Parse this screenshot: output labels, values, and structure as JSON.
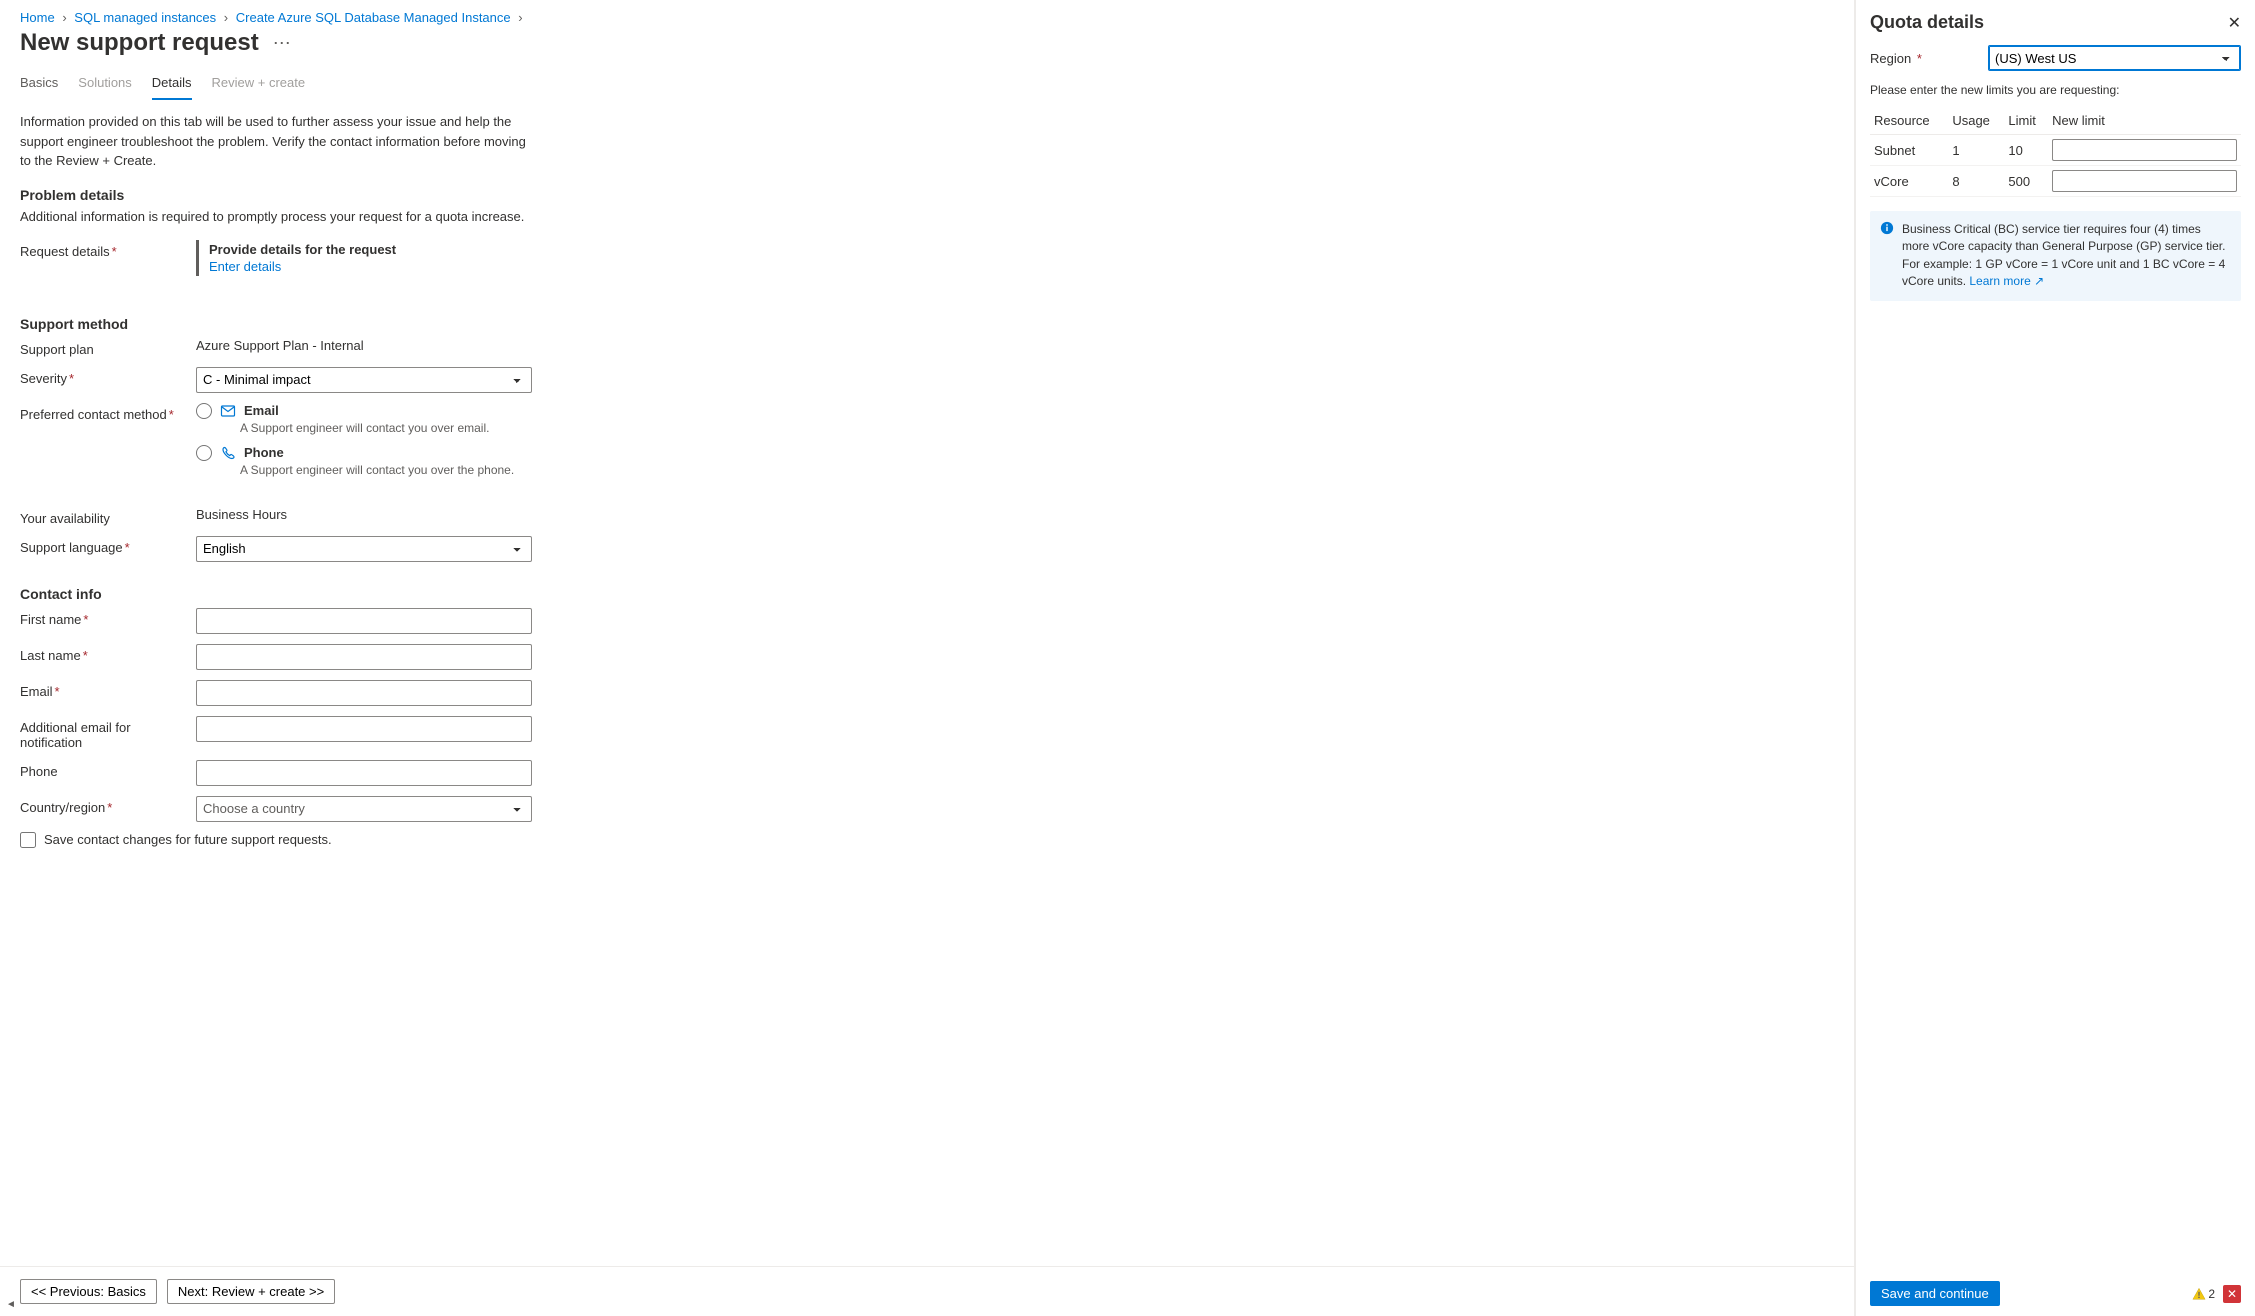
{
  "breadcrumb": [
    "Home",
    "SQL managed instances",
    "Create Azure SQL Database Managed Instance"
  ],
  "page_title": "New support request",
  "tabs": [
    {
      "label": "Basics",
      "state": "default"
    },
    {
      "label": "Solutions",
      "state": "disabled"
    },
    {
      "label": "Details",
      "state": "active"
    },
    {
      "label": "Review + create",
      "state": "disabled"
    }
  ],
  "intro": "Information provided on this tab will be used to further assess your issue and help the support engineer troubleshoot the problem. Verify the contact information before moving to the Review + Create.",
  "sections": {
    "problem_details": {
      "heading": "Problem details",
      "sub": "Additional information is required to promptly process your request for a quota increase.",
      "request_label": "Request details",
      "box_title": "Provide details for the request",
      "box_link": "Enter details"
    },
    "support_method": {
      "heading": "Support method",
      "support_plan_label": "Support plan",
      "support_plan_value": "Azure Support Plan - Internal",
      "severity_label": "Severity",
      "severity_value": "C - Minimal impact",
      "contact_label": "Preferred contact method",
      "email_opt": "Email",
      "email_desc": "A Support engineer will contact you over email.",
      "phone_opt": "Phone",
      "phone_desc": "A Support engineer will contact you over the phone.",
      "avail_label": "Your availability",
      "avail_value": "Business Hours",
      "lang_label": "Support language",
      "lang_value": "English"
    },
    "contact_info": {
      "heading": "Contact info",
      "first_name": "First name",
      "last_name": "Last name",
      "email": "Email",
      "addl_email": "Additional email for notification",
      "phone": "Phone",
      "country": "Country/region",
      "country_placeholder": "Choose a country",
      "save_cb": "Save contact changes for future support requests."
    }
  },
  "footer": {
    "prev": "<< Previous: Basics",
    "next": "Next: Review + create >>"
  },
  "side": {
    "title": "Quota details",
    "region_label": "Region",
    "region_value": "(US) West US",
    "prompt": "Please enter the new limits you are requesting:",
    "headers": {
      "resource": "Resource",
      "usage": "Usage",
      "limit": "Limit",
      "newlimit": "New limit"
    },
    "rows": [
      {
        "resource": "Subnet",
        "usage": "1",
        "limit": "10"
      },
      {
        "resource": "vCore",
        "usage": "8",
        "limit": "500"
      }
    ],
    "info": "Business Critical (BC) service tier requires four (4) times more vCore capacity than General Purpose (GP) service tier. For example: 1 GP vCore = 1 vCore unit and 1 BC vCore = 4 vCore units.",
    "learn_more": "Learn more",
    "save_btn": "Save and continue",
    "warn_count": "2"
  }
}
